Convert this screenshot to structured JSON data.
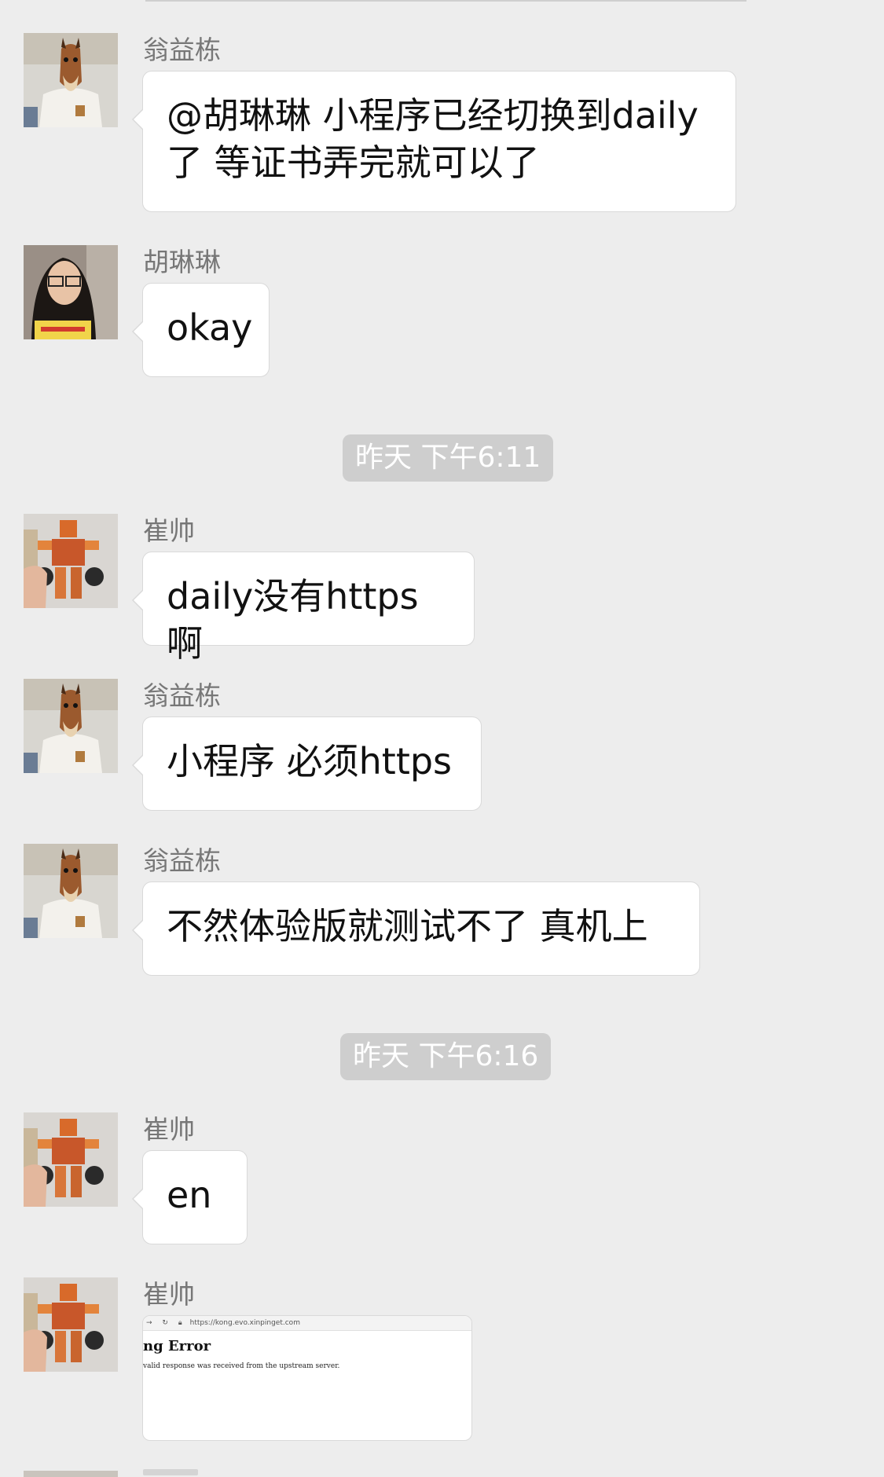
{
  "messages": [
    {
      "sender": "翁益栋",
      "text": "@胡琳琳 小程序已经切换到daily了 等证书弄完就可以了",
      "avatar": "horse-avatar"
    },
    {
      "sender": "胡琳琳",
      "text": "okay",
      "avatar": "woman-avatar"
    },
    {
      "sender": "崔帅",
      "text": "daily没有https啊",
      "avatar": "robot-toy-avatar"
    },
    {
      "sender": "翁益栋",
      "text": "小程序 必须https",
      "avatar": "horse-avatar"
    },
    {
      "sender": "翁益栋",
      "text": "不然体验版就测试不了 真机上",
      "avatar": "horse-avatar"
    },
    {
      "sender": "崔帅",
      "text": "en",
      "avatar": "robot-toy-avatar"
    },
    {
      "sender": "崔帅",
      "avatar": "robot-toy-avatar",
      "image": {
        "url": "https://kong.evo.xinpinget.com",
        "heading": "ng Error",
        "body": "valid response was received from the upstream server."
      }
    }
  ],
  "timestamps": [
    "昨天 下午6:11",
    "昨天 下午6:16"
  ],
  "colors": {
    "background": "#ededed",
    "bubble": "#ffffff",
    "timestamp_bg": "#cecece",
    "sender_text": "#777777"
  }
}
